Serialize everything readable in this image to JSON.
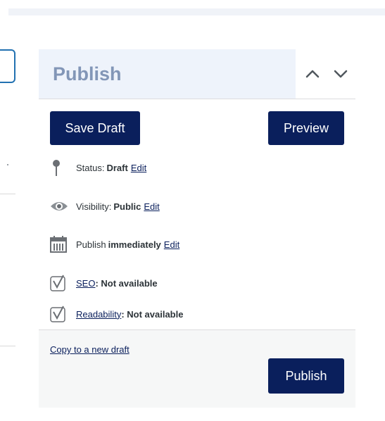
{
  "panel": {
    "title": "Publish",
    "save_draft_label": "Save Draft",
    "preview_label": "Preview",
    "status": {
      "label": "Status:",
      "value": "Draft",
      "edit": "Edit"
    },
    "visibility": {
      "label": "Visibility:",
      "value": "Public",
      "edit": "Edit"
    },
    "schedule": {
      "label": "Publish",
      "value": "immediately",
      "edit": "Edit"
    },
    "seo": {
      "link": "SEO",
      "text": ": Not available"
    },
    "readability": {
      "link": "Readability",
      "text": ": Not available"
    },
    "copy_link": "Copy to a new draft",
    "publish_label": "Publish"
  },
  "icons": {
    "collapse_up": "chevron-up-icon",
    "collapse_down": "chevron-down-icon",
    "status": "pin-icon",
    "visibility": "eye-icon",
    "schedule": "calendar-icon",
    "seo": "yoast-icon",
    "readability": "yoast-icon"
  },
  "colors": {
    "primary": "#0a1f5c",
    "title": "#8296b7",
    "header_bg": "#eef3fb"
  }
}
